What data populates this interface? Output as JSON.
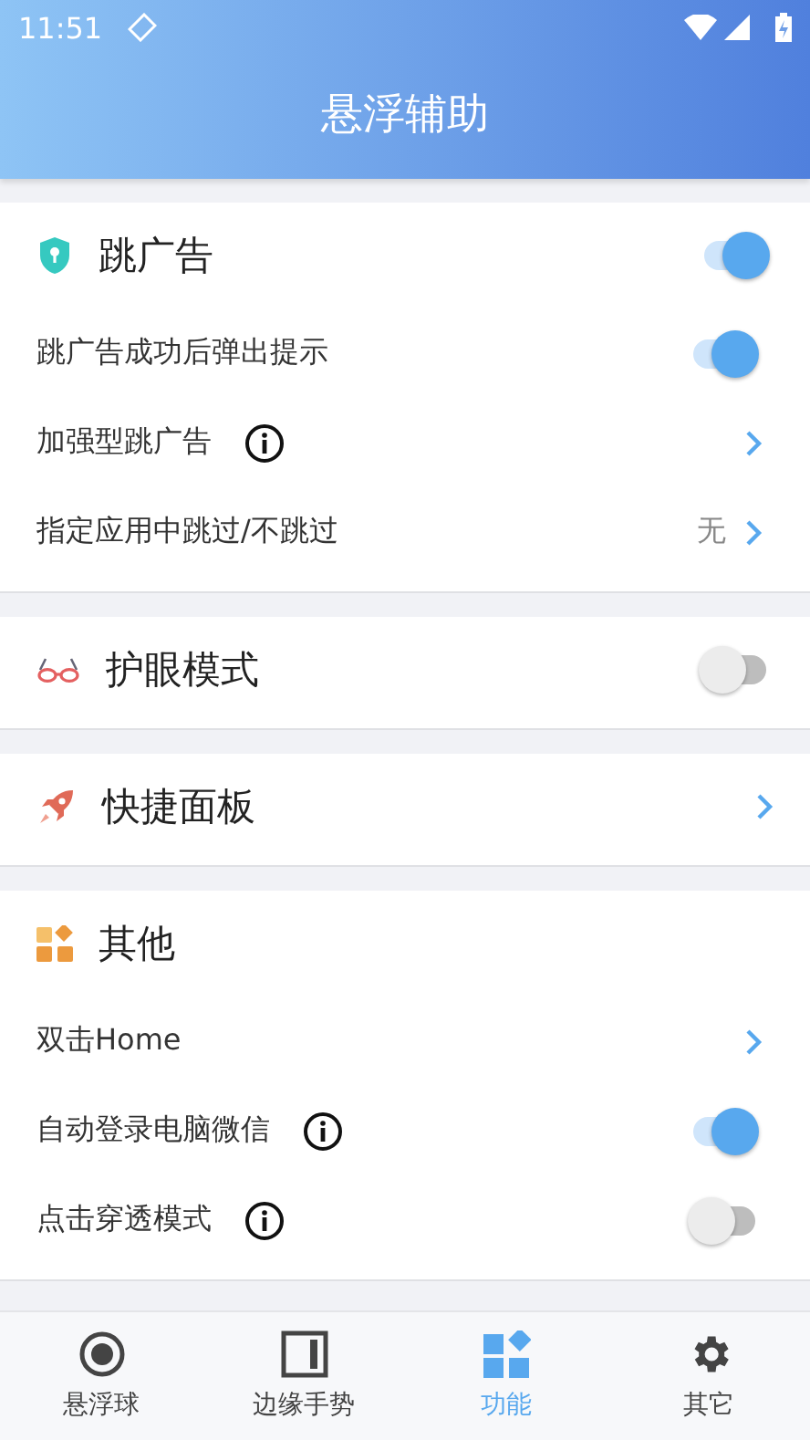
{
  "status_bar": {
    "time": "11:51"
  },
  "header": {
    "title": "悬浮辅助"
  },
  "sections": [
    {
      "kind": "toggle",
      "title": "跳广告",
      "on": true,
      "items": [
        {
          "kind": "toggle",
          "label": "跳广告成功后弹出提示",
          "on": true
        },
        {
          "kind": "link",
          "label": "加强型跳广告",
          "info": true
        },
        {
          "kind": "link",
          "label": "指定应用中跳过/不跳过",
          "value": "无"
        }
      ]
    },
    {
      "kind": "toggle",
      "title": "护眼模式",
      "on": false
    },
    {
      "kind": "link",
      "title": "快捷面板"
    },
    {
      "kind": "plain",
      "title": "其他",
      "items": [
        {
          "kind": "link",
          "label": "双击Home"
        },
        {
          "kind": "toggle",
          "label": "自动登录电脑微信",
          "info": true,
          "on": true
        },
        {
          "kind": "toggle",
          "label": "点击穿透模式",
          "info": true,
          "on": false
        }
      ]
    }
  ],
  "tabs": [
    {
      "label": "悬浮球",
      "selected": false
    },
    {
      "label": "边缘手势",
      "selected": false
    },
    {
      "label": "功能",
      "selected": true
    },
    {
      "label": "其它",
      "selected": false
    }
  ]
}
